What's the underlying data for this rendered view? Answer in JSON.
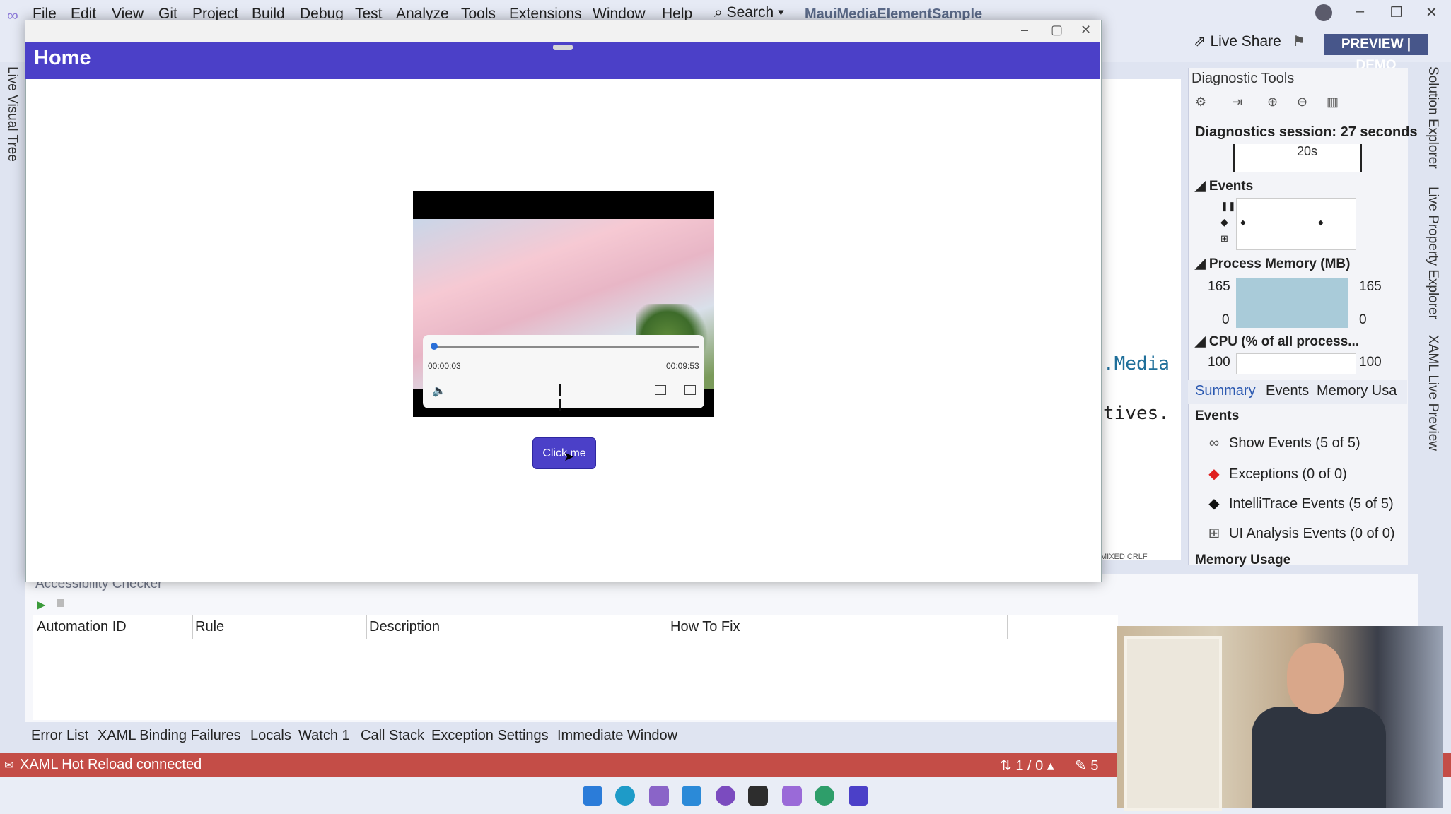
{
  "vs": {
    "menu": [
      "File",
      "Edit",
      "View",
      "Git",
      "Project",
      "Build",
      "Debug",
      "Test",
      "Analyze",
      "Tools",
      "Extensions",
      "Window",
      "Help"
    ],
    "search": "Search",
    "solution_title": "MauiMediaElementSample",
    "live_share": "Live Share",
    "preview_badge": "PREVIEW | DEMO",
    "left_rail_tab": "Live Visual Tree",
    "right_rail_tabs": [
      "Solution Explorer",
      "Live Property Explorer",
      "XAML Live Preview"
    ],
    "editor_fragment_1": ".Media",
    "editor_fragment_2": "tives.",
    "editor_status": "MIXED   CRLF"
  },
  "diagnostics": {
    "title": "Diagnostic Tools",
    "session": "Diagnostics session: 27 seconds",
    "tick": "20s",
    "events_section": "Events",
    "memory_section": "Process Memory (MB)",
    "memory_max": "165",
    "memory_min": "0",
    "cpu_section": "CPU (% of all process...",
    "cpu_max": "100",
    "tabs": [
      "Summary",
      "Events",
      "Memory Usa"
    ],
    "events_label": "Events",
    "event_rows": [
      {
        "icon": "show-events-icon",
        "label": "Show Events (5 of 5)"
      },
      {
        "icon": "exception-icon",
        "label": "Exceptions (0 of 0)"
      },
      {
        "icon": "intellitrace-icon",
        "label": "IntelliTrace Events (5 of 5)"
      },
      {
        "icon": "ui-analysis-icon",
        "label": "UI Analysis Events (0 of 0)"
      }
    ],
    "memory_usage_label": "Memory Usage"
  },
  "accessibility": {
    "title": "Accessibility Checker",
    "columns": [
      "Automation ID",
      "Rule",
      "Description",
      "How To Fix"
    ]
  },
  "tool_tabs": [
    "Error List",
    "XAML Binding Failures",
    "Locals",
    "Watch 1",
    "Call Stack",
    "Exception Settings",
    "Immediate Window"
  ],
  "status": {
    "hot_reload": "XAML Hot Reload connected",
    "git": "1 / 0",
    "pencil": "5"
  },
  "app": {
    "title": "Home",
    "media": {
      "current_time": "00:00:03",
      "total_time": "00:09:53",
      "progress": 0.005
    },
    "button_label": "Click me"
  },
  "colors": {
    "app_accent": "#4b40c8",
    "status_bar": "#c44d47",
    "vs_badge": "#47568a"
  }
}
